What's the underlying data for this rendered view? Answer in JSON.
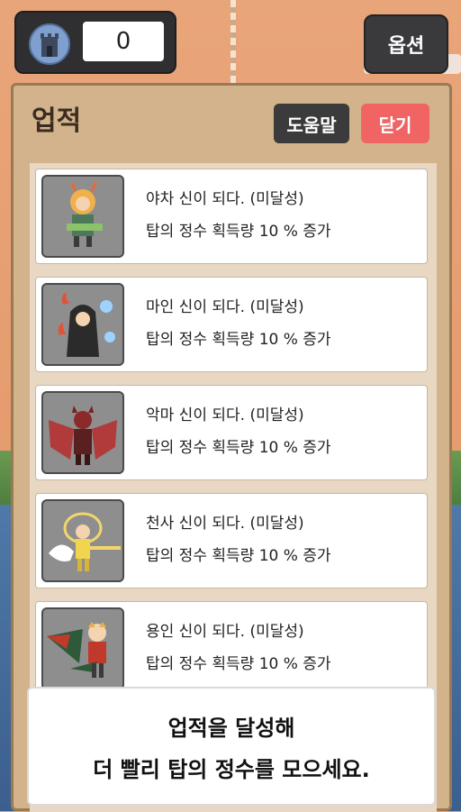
{
  "hud": {
    "score": "0",
    "tower_icon": "tower-icon",
    "options_label": "옵션"
  },
  "panel": {
    "title": "업적",
    "help_label": "도움말",
    "close_label": "닫기"
  },
  "achievements": [
    {
      "name": "야차 신이 되다. (미달성)",
      "desc": "탑의 정수 획득량 10 % 증가",
      "icon": "yaksha-portrait"
    },
    {
      "name": "마인 신이 되다. (미달성)",
      "desc": "탑의 정수 획득량 10 % 증가",
      "icon": "demon-mage-portrait"
    },
    {
      "name": "악마 신이 되다. (미달성)",
      "desc": "탑의 정수 획득량 10 % 증가",
      "icon": "devil-portrait"
    },
    {
      "name": "천사 신이 되다. (미달성)",
      "desc": "탑의 정수 획득량 10 % 증가",
      "icon": "angel-portrait"
    },
    {
      "name": "용인 신이 되다. (미달성)",
      "desc": "탑의 정수 획득량 10 % 증가",
      "icon": "dragon-portrait"
    }
  ],
  "tip": {
    "line1": "업적을 달성해",
    "line2": "더 빨리 탑의 정수를 모으세요."
  },
  "colors": {
    "close_button": "#f06464",
    "help_button": "#3b3b3b",
    "panel": "#d2b38c"
  }
}
